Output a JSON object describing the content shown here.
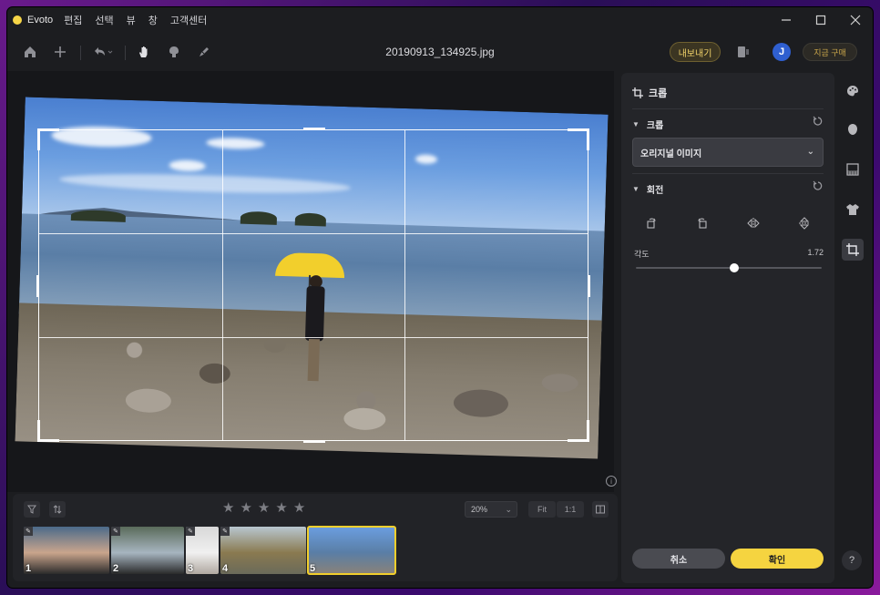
{
  "app": {
    "name": "Evoto",
    "filename": "20190913_134925.jpg"
  },
  "menu": [
    {
      "label": "편집"
    },
    {
      "label": "선택"
    },
    {
      "label": "뷰"
    },
    {
      "label": "창"
    },
    {
      "label": "고객센터"
    }
  ],
  "toolbar": {
    "export_label": "내보내기",
    "avatar_letter": "J",
    "buy_label": "지금 구매"
  },
  "panel": {
    "title": "크롭",
    "crop_section": "크롭",
    "aspect_selected": "오리지널 이미지",
    "rotate_section": "회전",
    "angle_label": "각도",
    "angle_value": "1.72",
    "angle_fraction": 0.53,
    "cancel_label": "취소",
    "ok_label": "확인"
  },
  "filmstrip": {
    "zoom": "20%",
    "fit_label": "Fit",
    "one_to_one_label": "1:1",
    "rating_stars": 5,
    "thumbnails": [
      {
        "num": "1",
        "edited": true,
        "selected": false,
        "colors": [
          "#4b6a8a",
          "#c9a58c",
          "#2b2b2b"
        ]
      },
      {
        "num": "2",
        "edited": true,
        "selected": false,
        "colors": [
          "#5a6b5a",
          "#a7b5c0",
          "#2a2a2a"
        ]
      },
      {
        "num": "3",
        "edited": true,
        "selected": false,
        "colors": [
          "#d8d8d8",
          "#f0f0f0",
          "#b0a8a0"
        ]
      },
      {
        "num": "4",
        "edited": true,
        "selected": false,
        "colors": [
          "#b8c6d0",
          "#8a7a50",
          "#6a6a5a"
        ]
      },
      {
        "num": "5",
        "edited": false,
        "selected": true,
        "colors": [
          "#6b9ee0",
          "#5a7ea6",
          "#8a8278"
        ]
      }
    ]
  },
  "colors": {
    "accent": "#f5d440",
    "panel_bg": "#242529",
    "window_bg": "#1c1d20"
  }
}
